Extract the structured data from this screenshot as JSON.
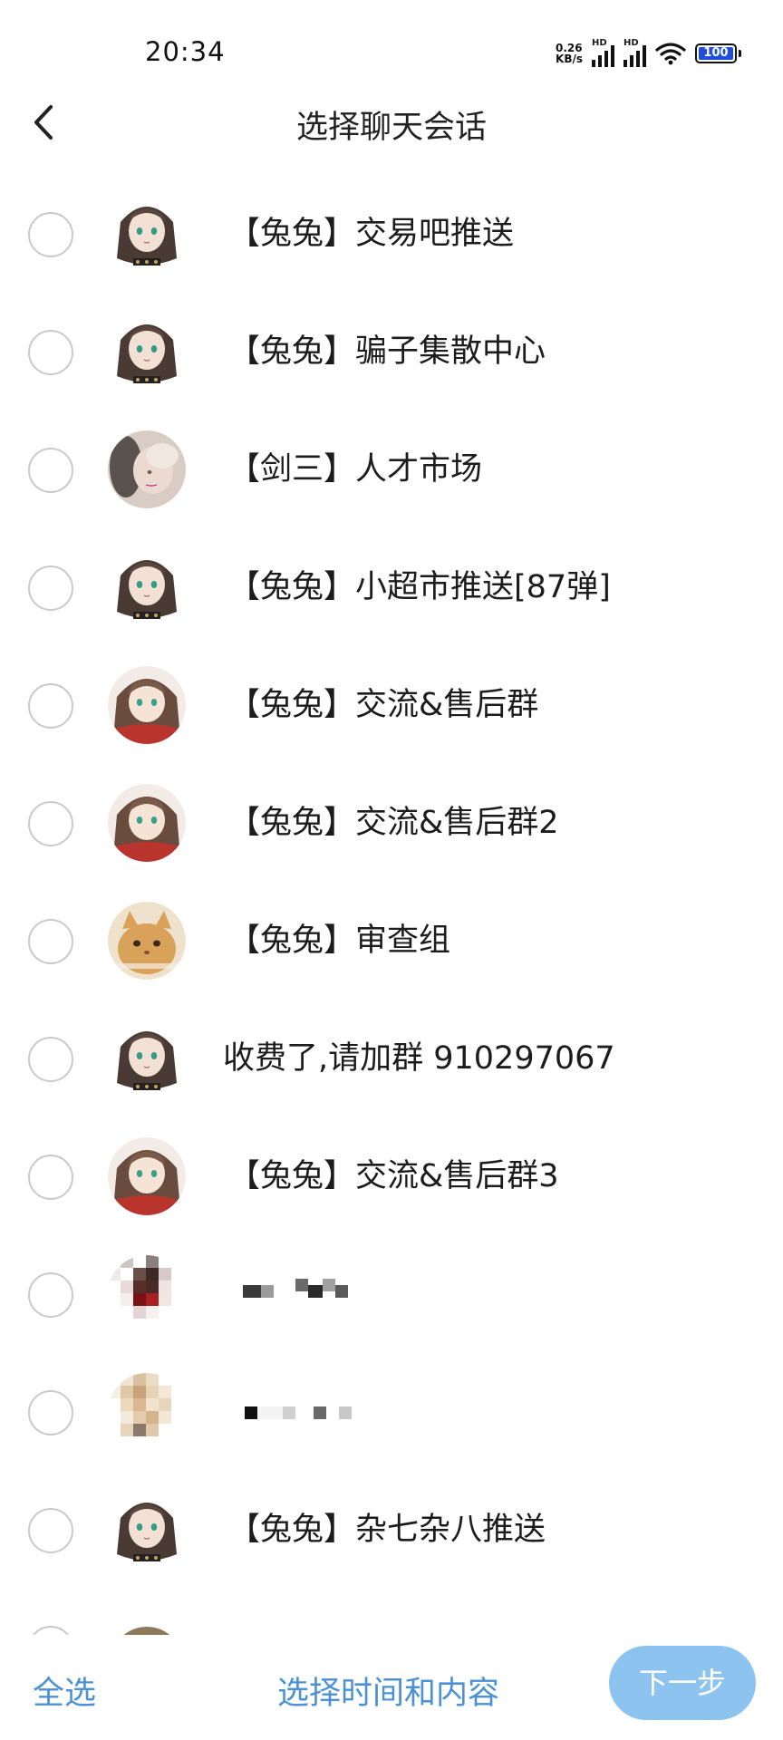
{
  "status_bar": {
    "time": "20:34",
    "net_speed_value": "0.26",
    "net_speed_unit": "KB/s",
    "signal_label": "HD",
    "battery_level": "100",
    "battery_fraction": 1.0,
    "wifi_icon": "wifi-icon"
  },
  "header": {
    "title": "选择聊天会话",
    "back_icon": "chevron-left-icon"
  },
  "chats": [
    {
      "name": "【兔兔】交易吧推送",
      "avatar": "anime-girl"
    },
    {
      "name": "【兔兔】骗子集散中心",
      "avatar": "anime-girl"
    },
    {
      "name": "【剑三】人才市场",
      "avatar": "soft-portrait"
    },
    {
      "name": "【兔兔】小超市推送[87弹]",
      "avatar": "anime-girl"
    },
    {
      "name": "【兔兔】交流&售后群",
      "avatar": "anime-girl-red"
    },
    {
      "name": "【兔兔】交流&售后群2",
      "avatar": "anime-girl-red"
    },
    {
      "name": "【兔兔】审查组",
      "avatar": "cat"
    },
    {
      "name": "收费了,请加群 910297067",
      "avatar": "anime-girl"
    },
    {
      "name": "【兔兔】交流&售后群3",
      "avatar": "anime-girl-red"
    },
    {
      "name": "",
      "avatar": "pixelated"
    },
    {
      "name": "",
      "avatar": "pixelated-beige"
    },
    {
      "name": "【兔兔】杂七杂八推送",
      "avatar": "anime-girl"
    },
    {
      "name": "",
      "avatar": "partial-dark"
    }
  ],
  "bottom_bar": {
    "select_all": "全选",
    "select_time_content": "选择时间和内容",
    "next_step": "下一步"
  },
  "colors": {
    "accent": "#4c90d6",
    "next_button_bg": "#8dc4ef",
    "radio_border": "#c9c9c9",
    "battery_fill": "#1f4fd8"
  }
}
